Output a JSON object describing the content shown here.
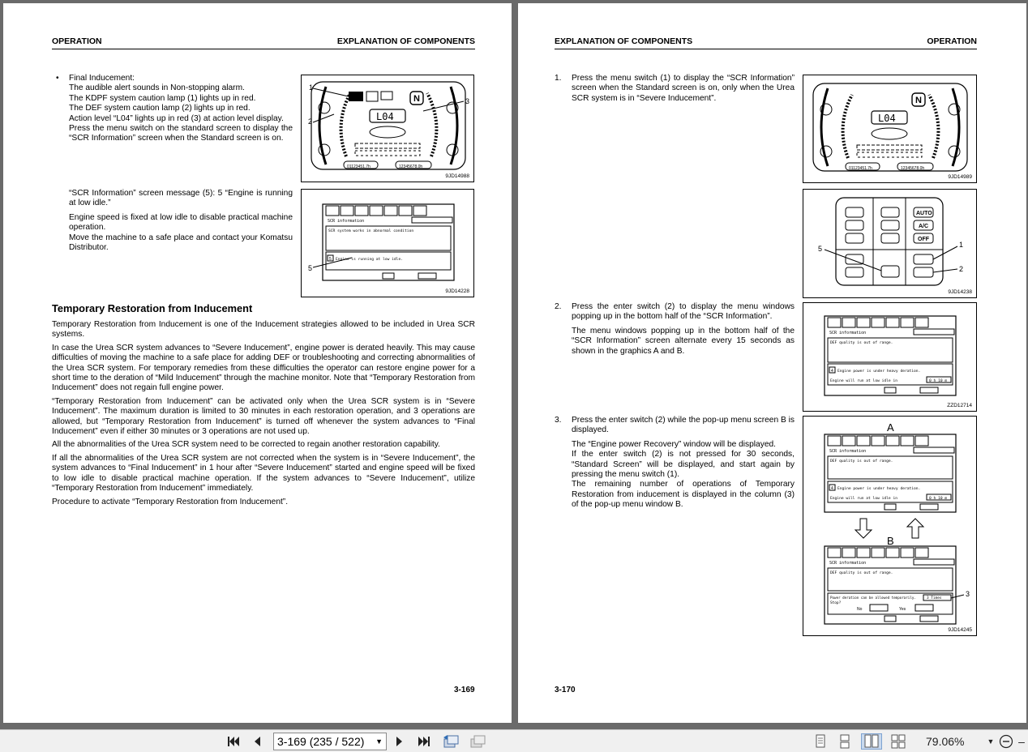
{
  "left_page": {
    "header_left": "OPERATION",
    "header_right": "EXPLANATION OF COMPONENTS",
    "bullet_title": "Final Inducement:",
    "bullet_lines": [
      "The audible alert sounds in Non-stopping alarm.",
      "The KDPF system caution lamp (1) lights up in red.",
      "The DEF system caution lamp (2) lights up in red.",
      "Action level “L04” lights up in red (3) at action level display.",
      "Press the menu switch on the standard screen to display the “SCR Information” screen when the Standard screen is on."
    ],
    "message_para": "“SCR Information” screen message (5): 5 “Engine is running at low idle.”",
    "speed_para": "Engine speed is fixed at low idle to disable practical machine operation.",
    "move_para": "Move the machine to a safe place and contact your Komatsu Distributor.",
    "section_title": "Temporary Restoration from Inducement",
    "paragraphs": [
      "Temporary Restoration from Inducement is one of the Inducement strategies allowed to be included in Urea SCR systems.",
      "In case the Urea SCR system advances to “Severe Inducement”, engine power is derated heavily. This may cause difficulties of moving the machine to a safe place for adding DEF or troubleshooting and correcting abnormalities of the Urea SCR system. For temporary remedies from these difficulties the operator can restore engine power for a short time to the deration of “Mild Inducement” through the machine monitor. Note that “Temporary Restoration from Inducement” does not regain full engine power.",
      "“Temporary Restoration from Inducement” can be activated only when the Urea SCR system is in “Severe Inducement”. The maximum duration is limited to 30 minutes in each restoration operation, and 3 operations are allowed, but “Temporary Restoration from Inducement” is turned off whenever the system advances to “Final Inducement” even if either 30 minutes or 3 operations are not used up.",
      "All the abnormalities of the Urea SCR system need to be corrected to regain another restoration capability.",
      "If all the abnormalities of the Urea SCR system are not corrected when the system is in “Severe Inducement”, the system advances to “Final Inducement” in 1 hour after “Severe Inducement” started and engine speed will be fixed to low idle to disable practical machine operation. If the system advances to “Severe Inducement”, utilize “Temporary Restoration from Inducement” immediately.",
      "Procedure to activate “Temporary Restoration from Inducement”."
    ],
    "page_number": "3-169",
    "fig1_caption": "9JD14988",
    "fig2_caption": "9JD14228",
    "fig1_callouts": [
      "1",
      "2",
      "3"
    ],
    "fig2_callout": "5",
    "monitor_level": "L04",
    "monitor_gear": "N",
    "monitor_hours_left": "01123451.7h",
    "monitor_hours_right": "12345678.0h",
    "fig2_title": "SCR information",
    "fig2_msg1": "SCR system works in abnormal condition",
    "fig2_msg2": "Engine is running at low idle.",
    "fig2_msg2_num": "5"
  },
  "right_page": {
    "header_left": "EXPLANATION OF COMPONENTS",
    "header_right": "OPERATION",
    "step1_num": "1.",
    "step1_text": "Press the menu switch (1) to display the “SCR Information” screen when the Standard screen is on, only when the Urea SCR system is in “Severe Inducement”.",
    "step2_num": "2.",
    "step2_text": "Press the enter switch (2) to display the menu windows popping up in the bottom half of the “SCR Information”.",
    "step2_text2": "The menu windows popping up in the bottom half of the “SCR Information” screen alternate every 15 seconds as shown in the graphics A and B.",
    "step3_num": "3.",
    "step3_text": "Press the enter switch (2) while the pop-up menu screen B is displayed.",
    "step3_text2": "The “Engine power Recovery” window will be displayed.",
    "step3_text3": "If the enter switch (2) is not pressed for 30 seconds, “Standard Screen” will be displayed, and start again by pressing the menu switch (1).",
    "step3_text4": "The remaining number of operations of Temporary Restoration from inducement is displayed in the column (3) of the pop-up menu window B.",
    "page_number": "3-170",
    "fig1_caption": "9JD14989",
    "fig2_caption": "9JD14238",
    "fig3_caption": "ZZD12714",
    "fig4_caption": "9JD14245",
    "monitor_level": "L04",
    "monitor_gear": "N",
    "monitor_hours_left": "01123451.7h",
    "monitor_hours_right": "12345678.0h",
    "switch_labels": {
      "auto": "AUTO",
      "ac": "A/C",
      "off": "OFF"
    },
    "switch_callouts": [
      "1",
      "2",
      "5"
    ],
    "scr_title": "SCR information",
    "scr_def_msg": "DEF quality is out of range.",
    "scr_derate_msg": "Engine power is under heavy deration.",
    "scr_low_idle_msg": "Engine will run at low idle in",
    "scr_time": "0 h 10 m",
    "scr_derate_num": "4",
    "label_a": "A",
    "label_b": "B",
    "popup_b_line1": "Power deration can be allowed temporarily.",
    "popup_b_line2": "Stop?",
    "popup_b_times": "3 Times",
    "popup_b_no": "No",
    "popup_b_yes": "Yes",
    "popup_b_callout": "3"
  },
  "toolbar": {
    "page_select_value": "3-169 (235 / 522)",
    "zoom_value": "79.06%",
    "icons": [
      "first-page-icon",
      "prev-page-icon",
      "next-page-icon",
      "last-page-icon",
      "go-back-icon",
      "go-forward-icon",
      "single-page-icon",
      "continuous-page-icon",
      "facing-pages-icon",
      "continuous-facing-icon",
      "zoom-dropdown-icon",
      "zoom-out-icon"
    ]
  }
}
